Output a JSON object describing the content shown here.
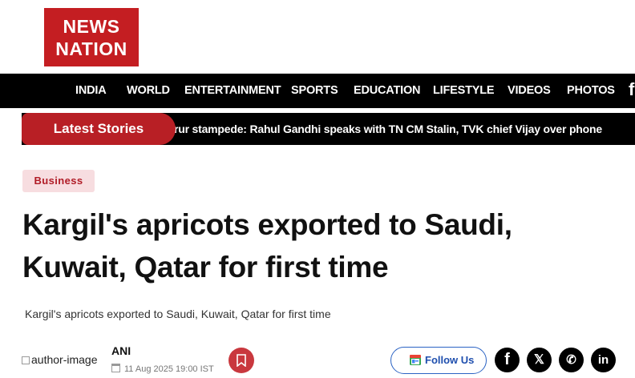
{
  "logo": {
    "line1": "NEWS",
    "line2": "NATION"
  },
  "nav": {
    "items": [
      {
        "label": "INDIA"
      },
      {
        "label": "WORLD"
      },
      {
        "label": "ENTERTAINMENT"
      },
      {
        "label": "SPORTS"
      },
      {
        "label": "EDUCATION"
      },
      {
        "label": "LIFESTYLE"
      },
      {
        "label": "VIDEOS"
      },
      {
        "label": "PHOTOS"
      }
    ],
    "more_glyph": "f"
  },
  "ticker": {
    "label": "Latest Stories",
    "text": "rur stampede: Rahul Gandhi speaks with TN CM Stalin, TVK chief Vijay over phone"
  },
  "article": {
    "category": "Business",
    "title": "Kargil's apricots exported to Saudi, Kuwait, Qatar for first time",
    "subtitle": "Kargil's apricots exported to Saudi, Kuwait, Qatar for first time",
    "author_image_alt": "author-image",
    "author": "ANI",
    "date": "11 Aug 2025 19:00 IST"
  },
  "actions": {
    "follow_label": "Follow Us",
    "social": [
      {
        "icon": "facebook-icon",
        "glyph": "f"
      },
      {
        "icon": "x-icon",
        "glyph": "𝕏"
      },
      {
        "icon": "whatsapp-icon",
        "glyph": "✆"
      },
      {
        "icon": "linkedin-icon",
        "glyph": "in"
      }
    ]
  },
  "colors": {
    "brand": "#c41e22",
    "ticker_label": "#b81f25",
    "category_bg": "#f7dde0",
    "follow_blue": "#1f4fae"
  }
}
